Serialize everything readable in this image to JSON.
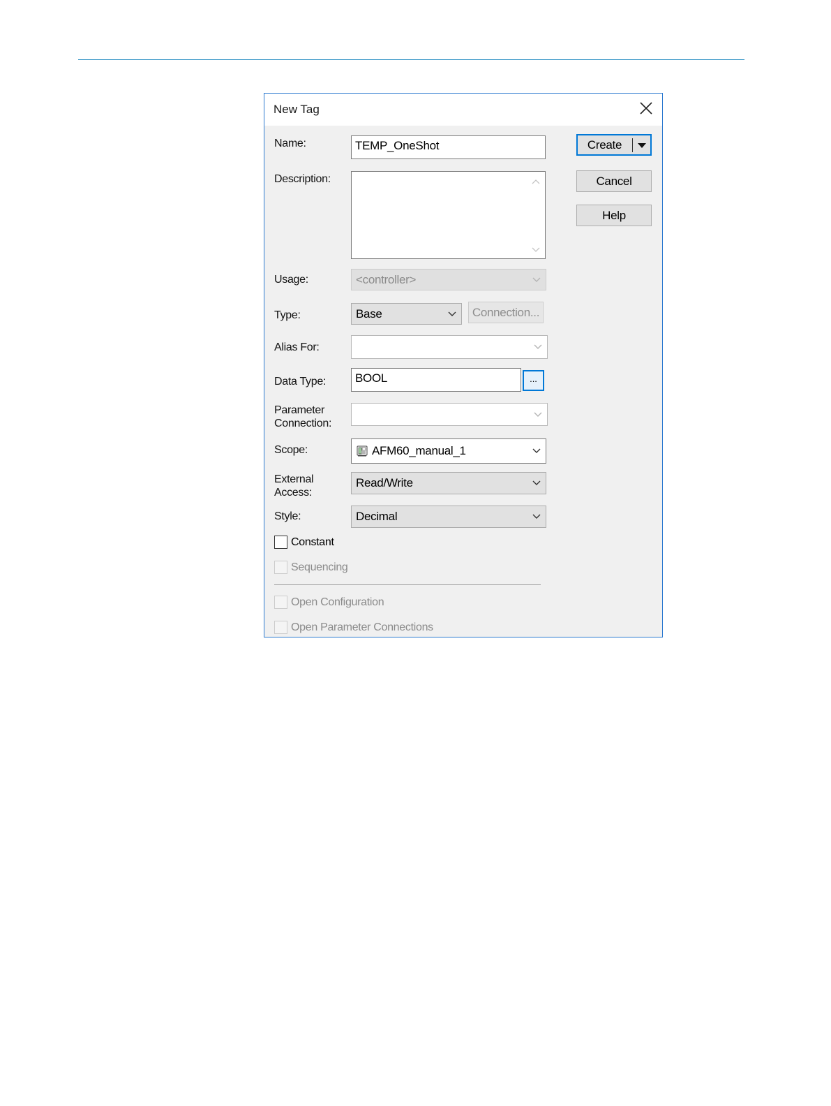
{
  "dialog": {
    "title": "New Tag",
    "close_icon": "close-icon",
    "accent_color": "#0078d7"
  },
  "fields": {
    "name": {
      "label": "Name:",
      "value": "TEMP_OneShot"
    },
    "description": {
      "label": "Description:",
      "value": ""
    },
    "usage": {
      "label": "Usage:",
      "value": "<controller>"
    },
    "type": {
      "label": "Type:",
      "value": "Base",
      "connection_button": "Connection..."
    },
    "alias_for": {
      "label": "Alias For:",
      "value": ""
    },
    "data_type": {
      "label": "Data Type:",
      "value": "BOOL",
      "browse_button": "..."
    },
    "parameter_connection": {
      "label_line1": "Parameter",
      "label_line2": "Connection:",
      "value": ""
    },
    "scope": {
      "label": "Scope:",
      "value": "AFM60_manual_1",
      "icon": "controller-icon"
    },
    "external_access": {
      "label_line1": "External",
      "label_line2": "Access:",
      "value": "Read/Write"
    },
    "style": {
      "label": "Style:",
      "value": "Decimal"
    }
  },
  "checkboxes": {
    "constant": {
      "label": "Constant",
      "checked": false
    },
    "sequencing": {
      "label": "Sequencing",
      "checked": false
    },
    "open_configuration": {
      "label": "Open Configuration",
      "checked": false
    },
    "open_parameter_connections": {
      "label": "Open Parameter Connections",
      "checked": false
    }
  },
  "buttons": {
    "create": "Create",
    "cancel": "Cancel",
    "help": "Help"
  }
}
